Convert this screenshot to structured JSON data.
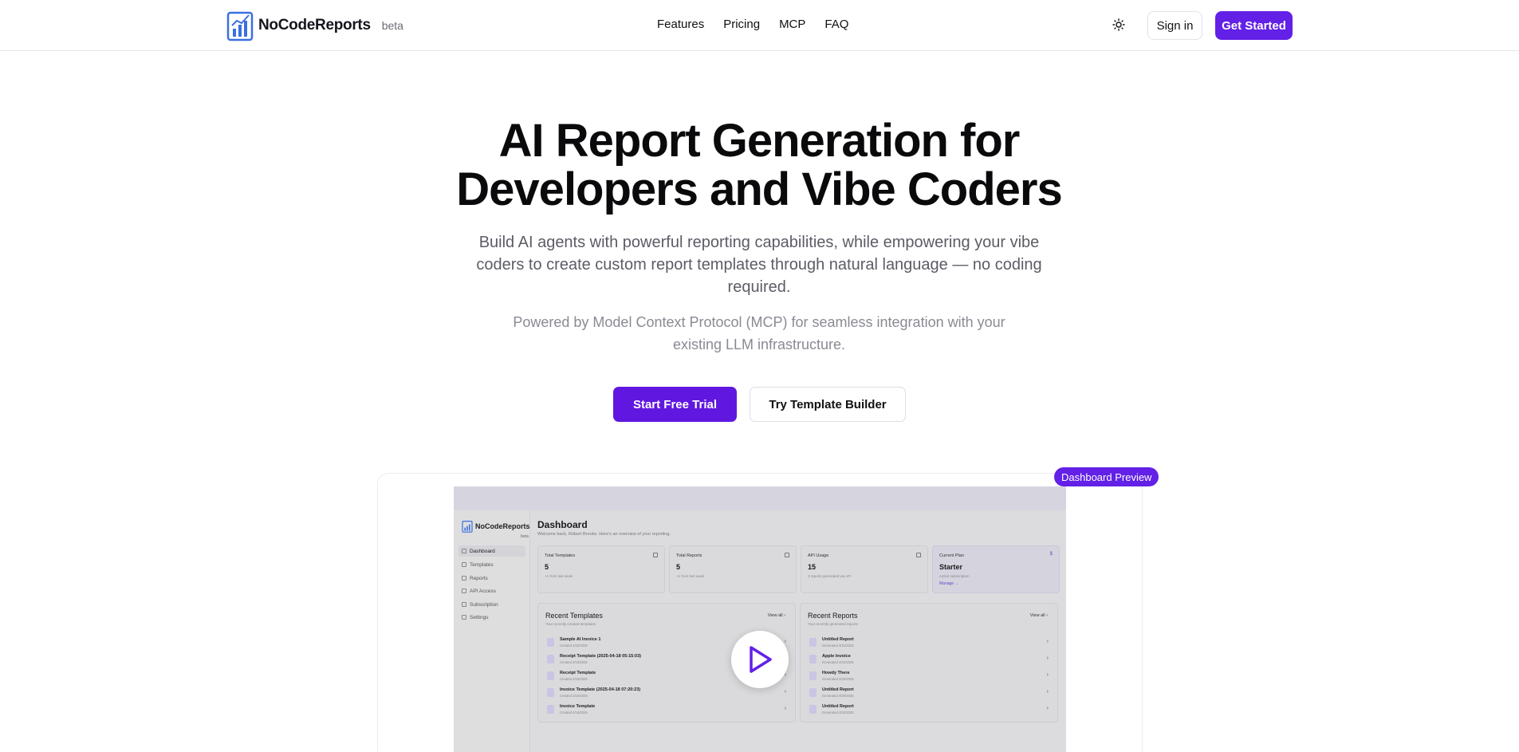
{
  "header": {
    "brand": "NoCodeReports",
    "beta": "beta",
    "nav": [
      "Features",
      "Pricing",
      "MCP",
      "FAQ"
    ],
    "signin": "Sign in",
    "get_started": "Get Started"
  },
  "hero": {
    "title_line1": "AI Report Generation for",
    "title_line2": "Developers and Vibe Coders",
    "subtitle": "Build AI agents with powerful reporting capabilities, while empowering your vibe coders to create custom report templates through natural language — no coding required.",
    "mcp": "Powered by Model Context Protocol (MCP) for seamless integration with your existing LLM infrastructure.",
    "cta_primary": "Start Free Trial",
    "cta_secondary": "Try Template Builder"
  },
  "preview": {
    "badge": "Dashboard Preview",
    "app": {
      "brand": "NoCodeReports",
      "beta": "beta",
      "sidebar": [
        "Dashboard",
        "Templates",
        "Reports",
        "API Access",
        "Subscription",
        "Settings"
      ],
      "title": "Dashboard",
      "welcome": "Welcome back, Robert Brooks. Here's an overview of your reporting.",
      "stats": [
        {
          "label": "Total Templates",
          "value": "5",
          "note": "+1 from last week"
        },
        {
          "label": "Total Reports",
          "value": "5",
          "note": "+1 from last week"
        },
        {
          "label": "API Usage",
          "value": "15",
          "note": "3 reports generated via API"
        },
        {
          "label": "Current Plan",
          "value": "Starter",
          "note": "Active subscription",
          "link": "Manage →",
          "badge": "$"
        }
      ],
      "recent_templates": {
        "title": "Recent Templates",
        "subtitle": "Your recently created templates",
        "view_all": "View all",
        "items": [
          {
            "name": "Sample AI Invoice 1",
            "date": "Created 4/22/2025"
          },
          {
            "name": "Receipt Template (2025-04-18 05:15:03)",
            "date": "Created 4/18/2025"
          },
          {
            "name": "Receipt Template",
            "date": "Created 4/16/2025"
          },
          {
            "name": "Invoice Template (2025-04-18 07:20:23)",
            "date": "Created 4/16/2025"
          },
          {
            "name": "Invoice Template",
            "date": "Created 4/16/2025"
          }
        ]
      },
      "recent_reports": {
        "title": "Recent Reports",
        "subtitle": "Your recently generated reports",
        "view_all": "View all",
        "items": [
          {
            "name": "Untitled Report",
            "date": "Generated 4/21/2025"
          },
          {
            "name": "Apple Invoice",
            "date": "Generated 4/21/2025"
          },
          {
            "name": "Howdy There",
            "date": "Generated 4/20/2025"
          },
          {
            "name": "Untitled Report",
            "date": "Generated 4/20/2025"
          },
          {
            "name": "Untitled Report",
            "date": "Generated 4/20/2025"
          }
        ]
      }
    }
  }
}
